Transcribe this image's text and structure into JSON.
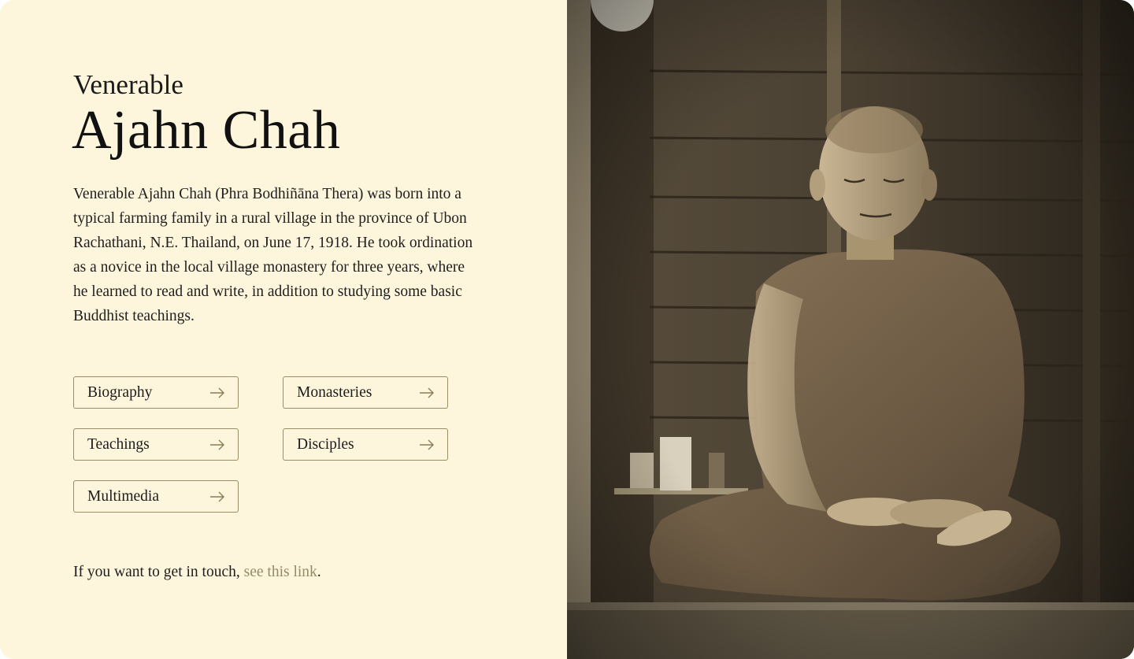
{
  "header": {
    "honorific": "Venerable",
    "name": "Ajahn Chah"
  },
  "bio": {
    "text": "Venerable Ajahn Chah (Phra Bodhiñāna Thera) was born into a typical farming family in a rural village in the province of Ubon Rachathani, N.E. Thailand, on June 17, 1918. He took ordination as a novice in the local village monastery for three years, where he learned to read and write, in addition to studying some basic Buddhist teachings."
  },
  "nav": {
    "items": [
      {
        "label": "Biography",
        "icon": "arrow-right-icon"
      },
      {
        "label": "Monasteries",
        "icon": "arrow-right-icon"
      },
      {
        "label": "Teachings",
        "icon": "arrow-right-icon"
      },
      {
        "label": "Disciples",
        "icon": "arrow-right-icon"
      },
      {
        "label": "Multimedia",
        "icon": "arrow-right-icon"
      }
    ]
  },
  "contact": {
    "prefix": "If you want to get in touch, ",
    "link_text": "see this link",
    "suffix": "."
  },
  "colors": {
    "background": "#fdf6dc",
    "border": "#9a8c64",
    "link": "#958a68",
    "text": "#141414"
  }
}
